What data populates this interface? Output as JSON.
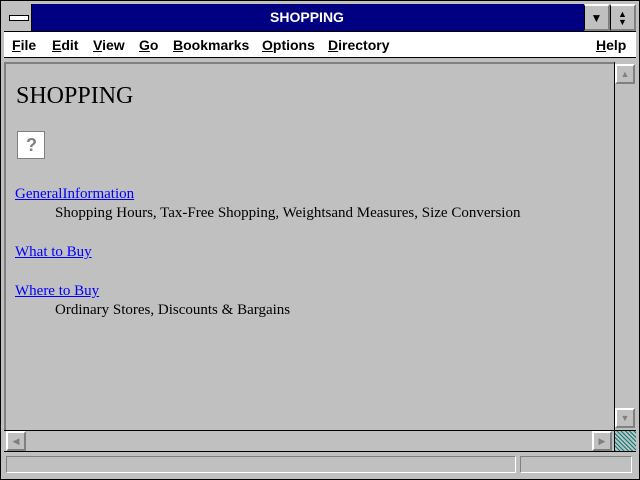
{
  "window": {
    "title": "SHOPPING",
    "minimize_icon": "down-triangle",
    "restore_icon": "up-down-triangles"
  },
  "menu": {
    "items": [
      "File",
      "Edit",
      "View",
      "Go",
      "Bookmarks",
      "Options",
      "Directory"
    ],
    "help": "Help"
  },
  "page": {
    "heading": "SHOPPING",
    "image_icon": "question-mark-image-placeholder",
    "sections": [
      {
        "link": "GeneralInformation ",
        "description": "Shopping Hours, Tax-Free Shopping, Weightsand Measures, Size Conversion"
      },
      {
        "link": "What to Buy ",
        "description": ""
      },
      {
        "link": "Where to Buy ",
        "description": "Ordinary Stores, Discounts & Bargains"
      }
    ]
  },
  "colors": {
    "title_bar": "#000080",
    "link": "#0000ff",
    "background": "#c0c0c0"
  }
}
